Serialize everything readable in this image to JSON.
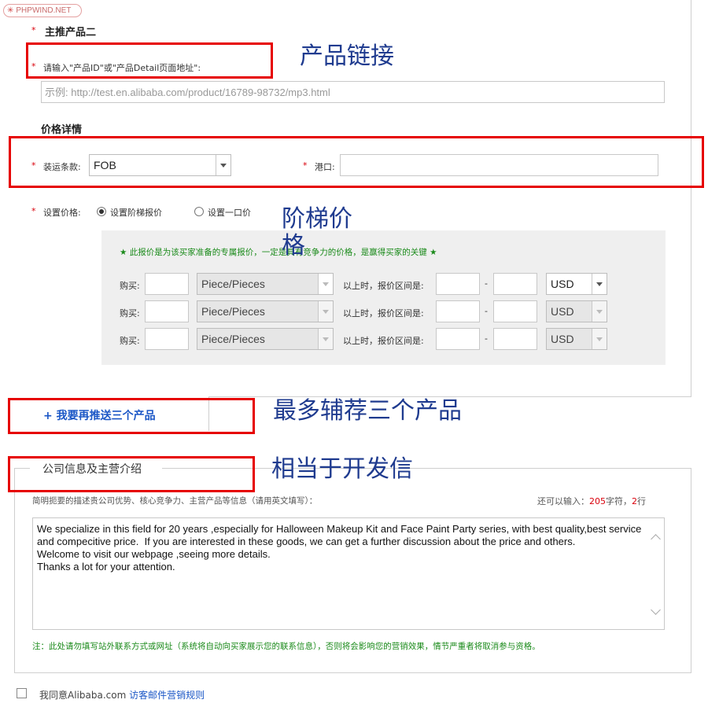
{
  "watermark": "PHPWIND.NET",
  "section_product2": {
    "title": "主推产品二",
    "link_label": "请输入\"产品ID\"或\"产品Detail页面地址\":",
    "link_placeholder": "示例: http://test.en.alibaba.com/product/16789-98732/mp3.html"
  },
  "price_details": {
    "title": "价格详情",
    "shipping_label": "装运条款:",
    "shipping_value": "FOB",
    "port_label": "港口:",
    "port_value": "",
    "set_price_label": "设置价格:",
    "radio_tiered": "设置阶梯报价",
    "radio_single": "设置一口价",
    "radio_selected": "tiered",
    "tier_note": "★ 此报价是为该买家准备的专属报价，一定是具有竞争力的价格，是赢得买家的关键 ★",
    "tiers": [
      {
        "buy_label": "购买:",
        "unit": "Piece/Pieces",
        "range_label": "以上时，报价区间是:",
        "dash": "-",
        "currency": "USD",
        "enabled": true
      },
      {
        "buy_label": "购买:",
        "unit": "Piece/Pieces",
        "range_label": "以上时，报价区间是:",
        "dash": "-",
        "currency": "USD",
        "enabled": false
      },
      {
        "buy_label": "购买:",
        "unit": "Piece/Pieces",
        "range_label": "以上时，报价区间是:",
        "dash": "-",
        "currency": "USD",
        "enabled": false
      }
    ]
  },
  "add_more_link": "+ 我要再推送三个产品",
  "company_info": {
    "legend": "公司信息及主营介绍",
    "desc_label": "简明扼要的描述贵公司优势、核心竞争力、主营产品等信息（请用英文填写）：",
    "remaining_prefix": "还可以输入：",
    "remaining_chars": "205",
    "remaining_mid": "字符，",
    "remaining_lines": "2",
    "remaining_suffix": "行",
    "textarea_value": "We specialize in this field for 20 years ,especially for Halloween Makeup Kit and Face Paint Party series, with best quality,best service and compecitive price.  If you are interested in these goods, we can get a further discussion about the price and others.\nWelcome to visit our webpage ,seeing more details.\nThanks a lot for your attention.",
    "note": "注：此处请勿填写站外联系方式或网址（系统将自动向买家展示您的联系信息），否则将会影响您的营销效果，情节严重者将取消参与资格。"
  },
  "agree": {
    "text": "我同意Alibaba.com",
    "link": "访客邮件营销规则"
  },
  "annotations": {
    "product_link": "产品链接",
    "tiered_price": "阶梯价\n格",
    "max_three": "最多辅荐三个产品",
    "equivalent_dev_letter": "相当于开发信"
  },
  "colors": {
    "annotation_box": "#e60000",
    "annotation_text": "#1f3b8f",
    "link": "#1a56c6",
    "required": "#d9000b",
    "note_green": "#1a8a1a"
  }
}
